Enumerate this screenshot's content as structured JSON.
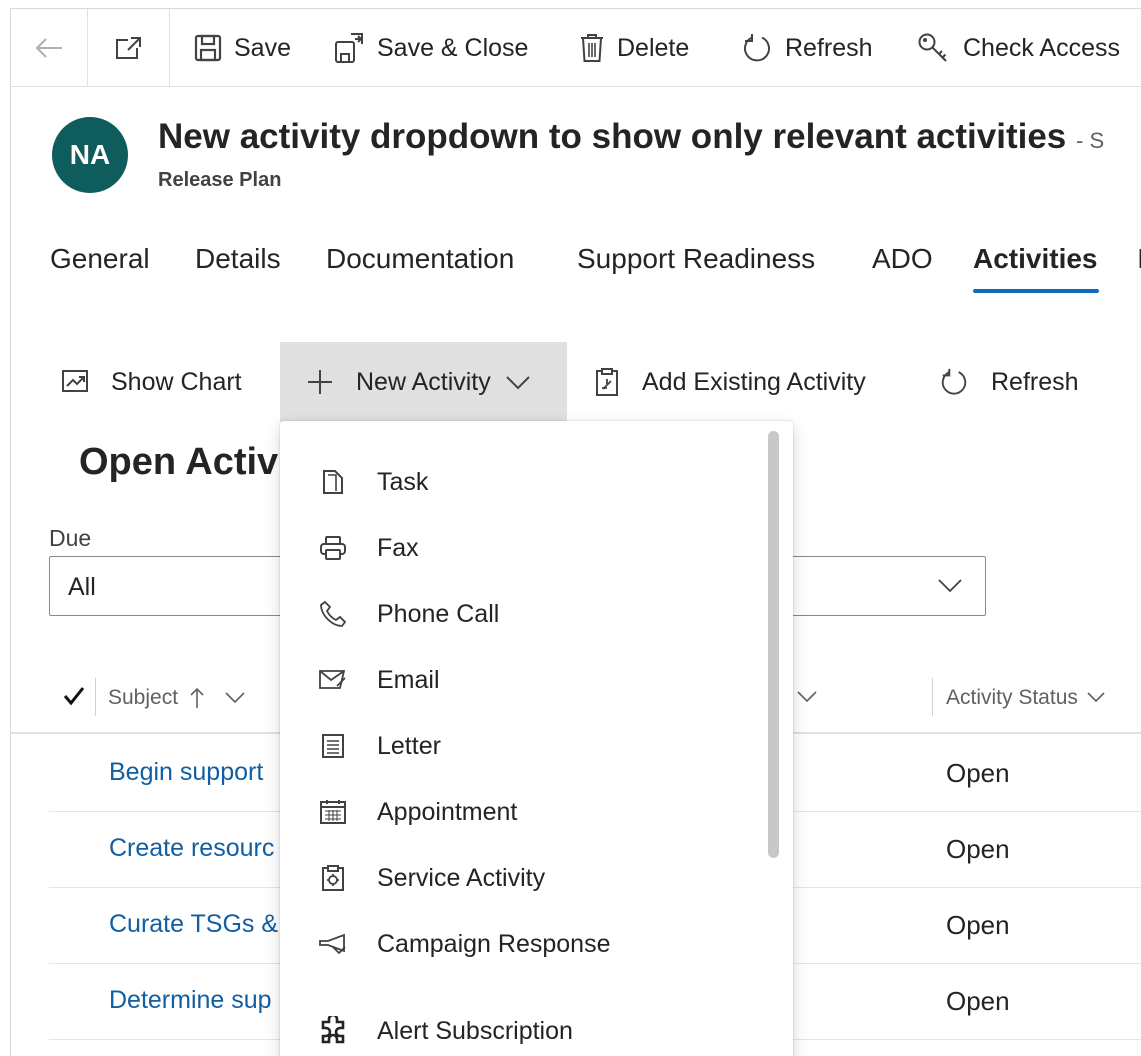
{
  "command_bar": {
    "save": "Save",
    "save_close": "Save & Close",
    "delete": "Delete",
    "refresh": "Refresh",
    "check_access": "Check Access"
  },
  "header": {
    "avatar_initials": "NA",
    "avatar_color": "#0f5c5c",
    "title": "New activity dropdown to show only relevant activities",
    "title_suffix": "- S",
    "entity": "Release Plan"
  },
  "tabs": [
    {
      "label": "General"
    },
    {
      "label": "Details"
    },
    {
      "label": "Documentation"
    },
    {
      "label": "Support Readiness"
    },
    {
      "label": "ADO"
    },
    {
      "label": "Activities",
      "active": true
    },
    {
      "label": "I"
    }
  ],
  "subgrid_bar": {
    "show_chart": "Show Chart",
    "new_activity": "New Activity",
    "add_existing": "Add Existing Activity",
    "refresh": "Refresh"
  },
  "section": {
    "title": "Open Activ",
    "due_label": "Due",
    "due_value": "All"
  },
  "grid": {
    "columns": [
      "Subject",
      "Activity Status"
    ],
    "rows": [
      {
        "subject": "Begin support",
        "status": "Open"
      },
      {
        "subject": "Create resourc",
        "status": "Open"
      },
      {
        "subject": "Curate TSGs &",
        "status": "Open"
      },
      {
        "subject": "Determine sup",
        "status": "Open"
      }
    ]
  },
  "menu": {
    "items": [
      {
        "label": "Task",
        "icon": "task-icon"
      },
      {
        "label": "Fax",
        "icon": "fax-icon"
      },
      {
        "label": "Phone Call",
        "icon": "phone-icon"
      },
      {
        "label": "Email",
        "icon": "email-icon"
      },
      {
        "label": "Letter",
        "icon": "letter-icon"
      },
      {
        "label": "Appointment",
        "icon": "calendar-icon"
      },
      {
        "label": "Service Activity",
        "icon": "service-activity-icon"
      },
      {
        "label": "Campaign Response",
        "icon": "campaign-response-icon"
      },
      {
        "label": "Alert Subscription",
        "icon": "puzzle-icon"
      }
    ]
  },
  "colors": {
    "accent": "#0f6cbd",
    "link": "#115ea3",
    "pressed_bg": "#e0e0e0"
  }
}
